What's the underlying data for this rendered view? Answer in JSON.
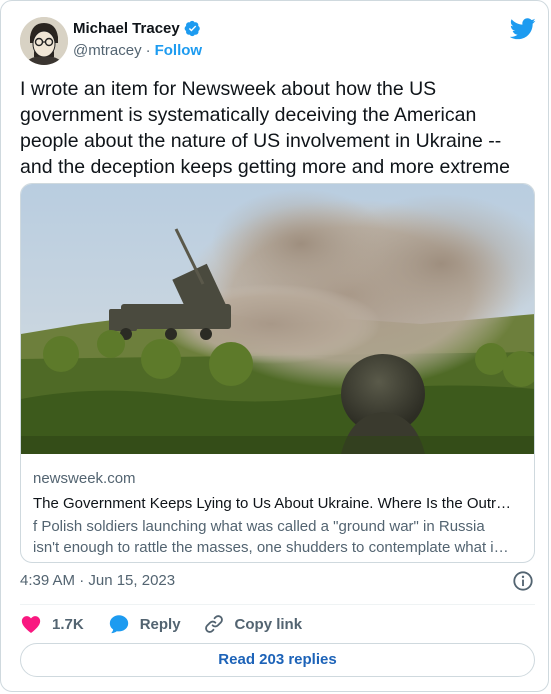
{
  "author": {
    "name": "Michael Tracey",
    "handle": "@mtracey",
    "separator": "·",
    "follow_label": "Follow",
    "verified": true
  },
  "tweet": {
    "lines": [
      "I wrote an item for Newsweek about how the US",
      "government is systematically deceiving the American",
      "people about the nature of US involvement in Ukraine --",
      "and the deception keeps getting more and more extreme"
    ]
  },
  "link_card": {
    "domain": "newsweek.com",
    "headline": "The Government Keeps Lying to Us About Ukraine. Where Is the Outr…",
    "description_lines": [
      "f Polish soldiers launching what was called a \"ground war\" in Russia",
      "isn't enough to rattle the masses, one shudders to contemplate what i…"
    ],
    "image_icon": "rocket-launcher-photo"
  },
  "meta": {
    "timestamp": "4:39 AM · Jun 15, 2023",
    "info_icon": "info-icon"
  },
  "actions": {
    "like_count": "1.7K",
    "reply_label": "Reply",
    "copy_label": "Copy link"
  },
  "footer": {
    "read_replies_label": "Read 203 replies"
  },
  "colors": {
    "accent": "#1d9bf0",
    "like": "#f91880",
    "secondary_text": "#536471",
    "border": "#cfd9de"
  }
}
